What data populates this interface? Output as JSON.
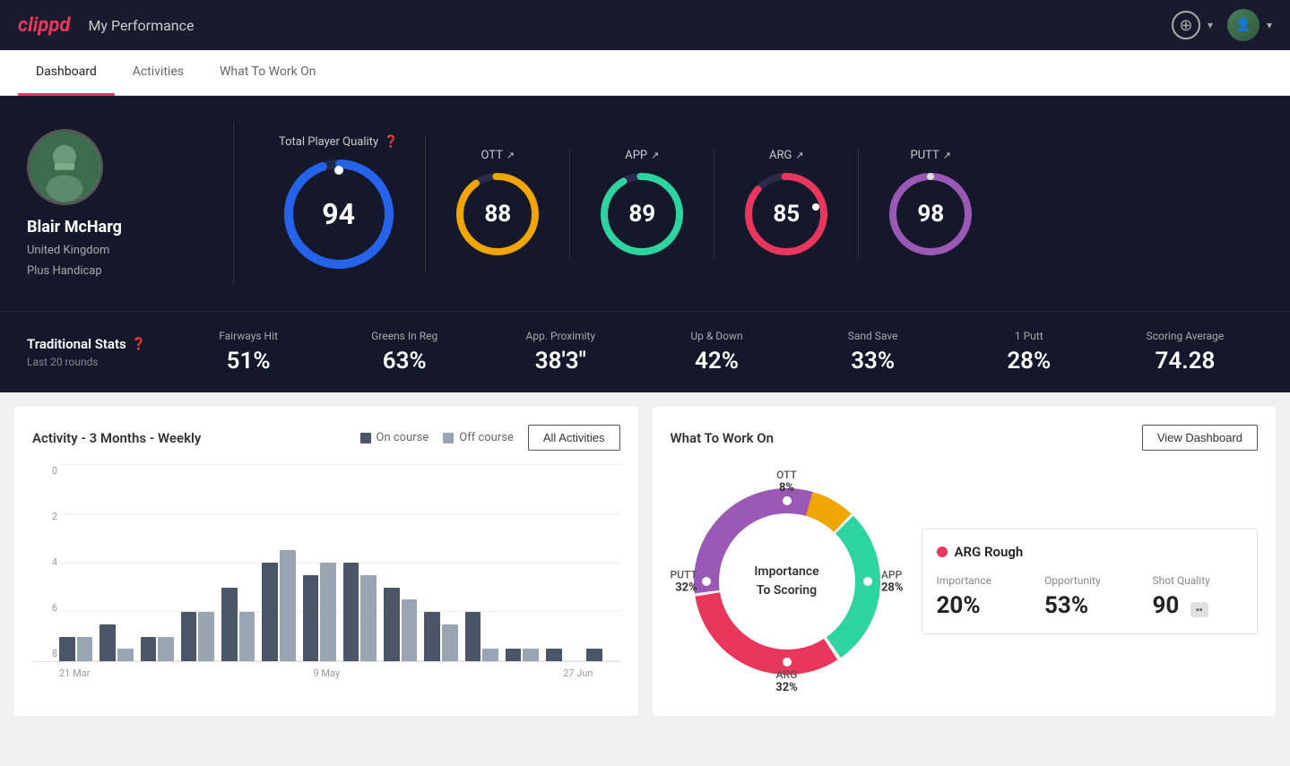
{
  "app": {
    "logo": "clippd",
    "header_title": "My Performance"
  },
  "tabs": [
    {
      "label": "Dashboard",
      "active": true
    },
    {
      "label": "Activities",
      "active": false
    },
    {
      "label": "What To Work On",
      "active": false
    }
  ],
  "player": {
    "name": "Blair McHarg",
    "country": "United Kingdom",
    "handicap": "Plus Handicap"
  },
  "total_quality": {
    "label": "Total Player Quality",
    "value": 94
  },
  "scores": [
    {
      "label": "OTT",
      "value": 88,
      "color": "#f0a500",
      "track": "#2a2a4a"
    },
    {
      "label": "APP",
      "value": 89,
      "color": "#2dd4a0",
      "track": "#2a2a4a"
    },
    {
      "label": "ARG",
      "value": 85,
      "color": "#e8365d",
      "track": "#2a2a4a"
    },
    {
      "label": "PUTT",
      "value": 98,
      "color": "#9b59b6",
      "track": "#2a2a4a"
    }
  ],
  "trad_stats": {
    "label": "Traditional Stats",
    "sublabel": "Last 20 rounds",
    "stats": [
      {
        "name": "Fairways Hit",
        "value": "51%"
      },
      {
        "name": "Greens In Reg",
        "value": "63%"
      },
      {
        "name": "App. Proximity",
        "value": "38'3\""
      },
      {
        "name": "Up & Down",
        "value": "42%"
      },
      {
        "name": "Sand Save",
        "value": "33%"
      },
      {
        "name": "1 Putt",
        "value": "28%"
      },
      {
        "name": "Scoring Average",
        "value": "74.28"
      }
    ]
  },
  "activity_chart": {
    "title": "Activity - 3 Months - Weekly",
    "legend": {
      "on_course": "On course",
      "off_course": "Off course"
    },
    "btn": "All Activities",
    "x_labels": [
      "21 Mar",
      "9 May",
      "27 Jun"
    ],
    "y_labels": [
      "0",
      "2",
      "4",
      "6",
      "8"
    ],
    "bars": [
      {
        "on": 1,
        "off": 1
      },
      {
        "on": 1.5,
        "off": 0.5
      },
      {
        "on": 1,
        "off": 1
      },
      {
        "on": 2,
        "off": 2
      },
      {
        "on": 3,
        "off": 2
      },
      {
        "on": 4,
        "off": 4.5
      },
      {
        "on": 3.5,
        "off": 4
      },
      {
        "on": 4,
        "off": 3.5
      },
      {
        "on": 3,
        "off": 2.5
      },
      {
        "on": 2,
        "off": 1.5
      },
      {
        "on": 2,
        "off": 0.5
      },
      {
        "on": 0.5,
        "off": 0.5
      },
      {
        "on": 0.5,
        "off": 0
      },
      {
        "on": 0.5,
        "off": 0
      }
    ]
  },
  "what_to_work_on": {
    "title": "What To Work On",
    "btn": "View Dashboard",
    "center_label": "Importance\nTo Scoring",
    "segments": [
      {
        "label": "OTT",
        "pct": "8%",
        "color": "#f0a500",
        "degrees": 29
      },
      {
        "label": "APP",
        "pct": "28%",
        "color": "#2dd4a0",
        "degrees": 101
      },
      {
        "label": "ARG",
        "pct": "32%",
        "color": "#e8365d",
        "degrees": 115
      },
      {
        "label": "PUTT",
        "pct": "32%",
        "color": "#9b59b6",
        "degrees": 115
      }
    ],
    "info_card": {
      "label": "ARG Rough",
      "color": "#e8365d",
      "importance": "20%",
      "opportunity": "53%",
      "shot_quality": "90"
    }
  }
}
